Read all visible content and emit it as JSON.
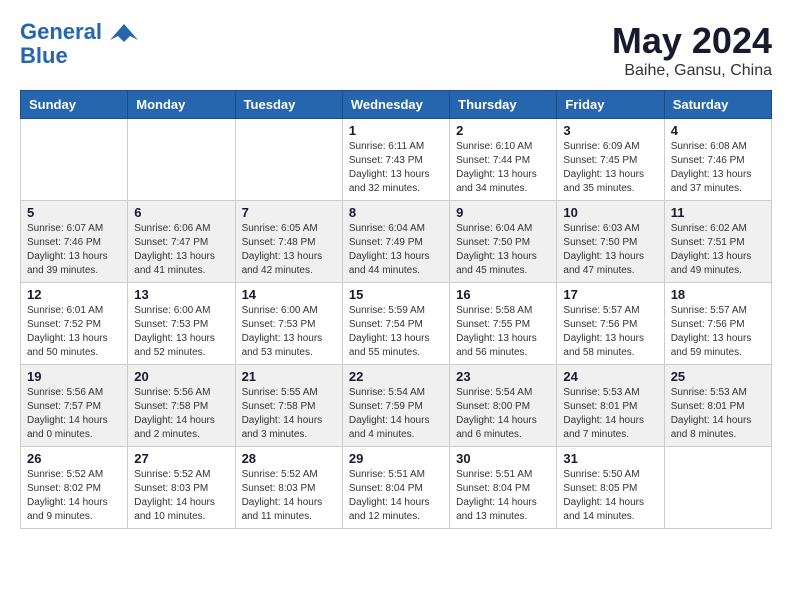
{
  "header": {
    "logo_line1": "General",
    "logo_line2": "Blue",
    "month": "May 2024",
    "location": "Baihe, Gansu, China"
  },
  "weekdays": [
    "Sunday",
    "Monday",
    "Tuesday",
    "Wednesday",
    "Thursday",
    "Friday",
    "Saturday"
  ],
  "weeks": [
    [
      {
        "day": "",
        "info": ""
      },
      {
        "day": "",
        "info": ""
      },
      {
        "day": "",
        "info": ""
      },
      {
        "day": "1",
        "info": "Sunrise: 6:11 AM\nSunset: 7:43 PM\nDaylight: 13 hours\nand 32 minutes."
      },
      {
        "day": "2",
        "info": "Sunrise: 6:10 AM\nSunset: 7:44 PM\nDaylight: 13 hours\nand 34 minutes."
      },
      {
        "day": "3",
        "info": "Sunrise: 6:09 AM\nSunset: 7:45 PM\nDaylight: 13 hours\nand 35 minutes."
      },
      {
        "day": "4",
        "info": "Sunrise: 6:08 AM\nSunset: 7:46 PM\nDaylight: 13 hours\nand 37 minutes."
      }
    ],
    [
      {
        "day": "5",
        "info": "Sunrise: 6:07 AM\nSunset: 7:46 PM\nDaylight: 13 hours\nand 39 minutes."
      },
      {
        "day": "6",
        "info": "Sunrise: 6:06 AM\nSunset: 7:47 PM\nDaylight: 13 hours\nand 41 minutes."
      },
      {
        "day": "7",
        "info": "Sunrise: 6:05 AM\nSunset: 7:48 PM\nDaylight: 13 hours\nand 42 minutes."
      },
      {
        "day": "8",
        "info": "Sunrise: 6:04 AM\nSunset: 7:49 PM\nDaylight: 13 hours\nand 44 minutes."
      },
      {
        "day": "9",
        "info": "Sunrise: 6:04 AM\nSunset: 7:50 PM\nDaylight: 13 hours\nand 45 minutes."
      },
      {
        "day": "10",
        "info": "Sunrise: 6:03 AM\nSunset: 7:50 PM\nDaylight: 13 hours\nand 47 minutes."
      },
      {
        "day": "11",
        "info": "Sunrise: 6:02 AM\nSunset: 7:51 PM\nDaylight: 13 hours\nand 49 minutes."
      }
    ],
    [
      {
        "day": "12",
        "info": "Sunrise: 6:01 AM\nSunset: 7:52 PM\nDaylight: 13 hours\nand 50 minutes."
      },
      {
        "day": "13",
        "info": "Sunrise: 6:00 AM\nSunset: 7:53 PM\nDaylight: 13 hours\nand 52 minutes."
      },
      {
        "day": "14",
        "info": "Sunrise: 6:00 AM\nSunset: 7:53 PM\nDaylight: 13 hours\nand 53 minutes."
      },
      {
        "day": "15",
        "info": "Sunrise: 5:59 AM\nSunset: 7:54 PM\nDaylight: 13 hours\nand 55 minutes."
      },
      {
        "day": "16",
        "info": "Sunrise: 5:58 AM\nSunset: 7:55 PM\nDaylight: 13 hours\nand 56 minutes."
      },
      {
        "day": "17",
        "info": "Sunrise: 5:57 AM\nSunset: 7:56 PM\nDaylight: 13 hours\nand 58 minutes."
      },
      {
        "day": "18",
        "info": "Sunrise: 5:57 AM\nSunset: 7:56 PM\nDaylight: 13 hours\nand 59 minutes."
      }
    ],
    [
      {
        "day": "19",
        "info": "Sunrise: 5:56 AM\nSunset: 7:57 PM\nDaylight: 14 hours\nand 0 minutes."
      },
      {
        "day": "20",
        "info": "Sunrise: 5:56 AM\nSunset: 7:58 PM\nDaylight: 14 hours\nand 2 minutes."
      },
      {
        "day": "21",
        "info": "Sunrise: 5:55 AM\nSunset: 7:58 PM\nDaylight: 14 hours\nand 3 minutes."
      },
      {
        "day": "22",
        "info": "Sunrise: 5:54 AM\nSunset: 7:59 PM\nDaylight: 14 hours\nand 4 minutes."
      },
      {
        "day": "23",
        "info": "Sunrise: 5:54 AM\nSunset: 8:00 PM\nDaylight: 14 hours\nand 6 minutes."
      },
      {
        "day": "24",
        "info": "Sunrise: 5:53 AM\nSunset: 8:01 PM\nDaylight: 14 hours\nand 7 minutes."
      },
      {
        "day": "25",
        "info": "Sunrise: 5:53 AM\nSunset: 8:01 PM\nDaylight: 14 hours\nand 8 minutes."
      }
    ],
    [
      {
        "day": "26",
        "info": "Sunrise: 5:52 AM\nSunset: 8:02 PM\nDaylight: 14 hours\nand 9 minutes."
      },
      {
        "day": "27",
        "info": "Sunrise: 5:52 AM\nSunset: 8:03 PM\nDaylight: 14 hours\nand 10 minutes."
      },
      {
        "day": "28",
        "info": "Sunrise: 5:52 AM\nSunset: 8:03 PM\nDaylight: 14 hours\nand 11 minutes."
      },
      {
        "day": "29",
        "info": "Sunrise: 5:51 AM\nSunset: 8:04 PM\nDaylight: 14 hours\nand 12 minutes."
      },
      {
        "day": "30",
        "info": "Sunrise: 5:51 AM\nSunset: 8:04 PM\nDaylight: 14 hours\nand 13 minutes."
      },
      {
        "day": "31",
        "info": "Sunrise: 5:50 AM\nSunset: 8:05 PM\nDaylight: 14 hours\nand 14 minutes."
      },
      {
        "day": "",
        "info": ""
      }
    ]
  ]
}
